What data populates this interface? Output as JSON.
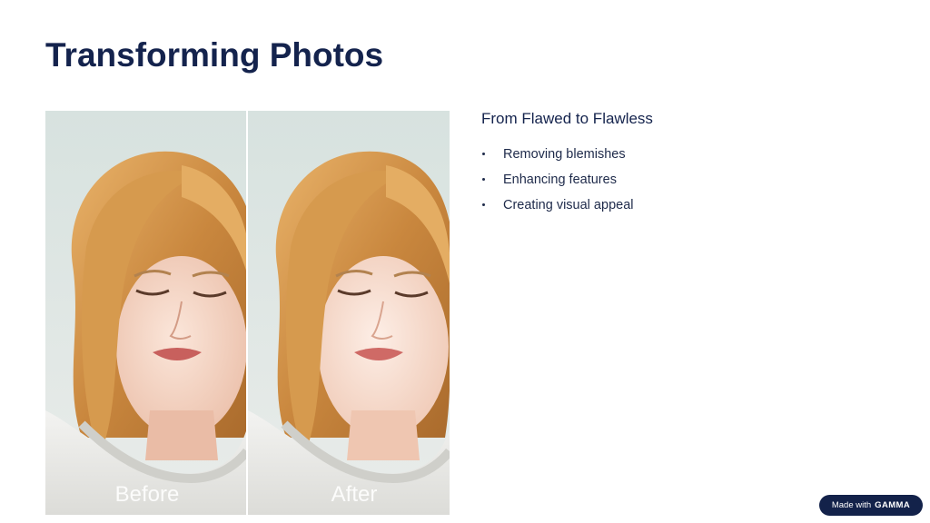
{
  "slide": {
    "title": "Transforming Photos",
    "subtitle": "From Flawed to Flawless",
    "bullets": [
      "Removing blemishes",
      "Enhancing features",
      "Creating visual appeal"
    ]
  },
  "image": {
    "before_label": "Before",
    "after_label": "After"
  },
  "badge": {
    "prefix": "Made with",
    "brand": "GAMMA"
  },
  "colors": {
    "title": "#14234d",
    "badge_bg": "#13224a",
    "text": "#1e2a4a"
  }
}
